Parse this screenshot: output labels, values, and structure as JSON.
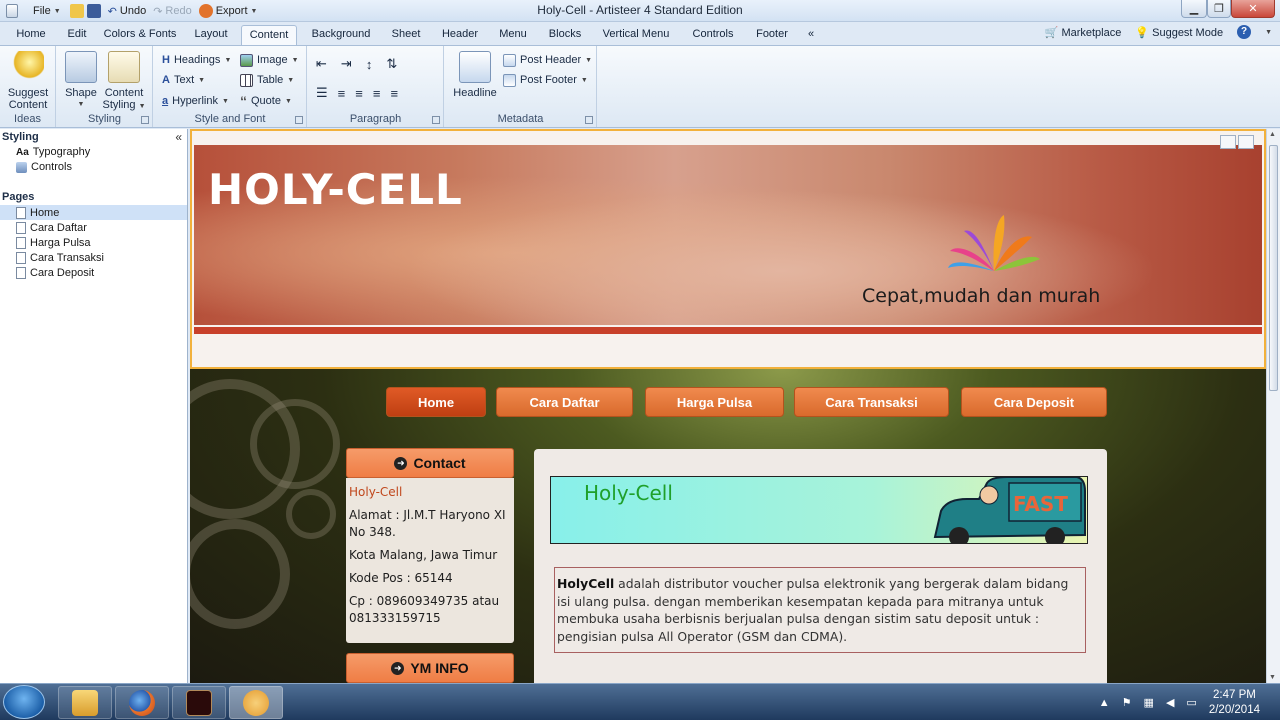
{
  "window": {
    "title": "Holy-Cell - Artisteer 4 Standard Edition",
    "quick_access": {
      "file": "File",
      "undo": "Undo",
      "redo": "Redo",
      "export": "Export"
    }
  },
  "ribbon_tabs": [
    "Home",
    "Edit",
    "Colors & Fonts",
    "Layout",
    "Content",
    "Background",
    "Sheet",
    "Header",
    "Menu",
    "Blocks",
    "Vertical Menu",
    "Controls",
    "Footer",
    "«"
  ],
  "active_tab": "Content",
  "right_links": {
    "marketplace": "Marketplace",
    "suggest_mode": "Suggest Mode"
  },
  "ribbon": {
    "ideas": {
      "label": "Ideas",
      "suggest_line1": "Suggest",
      "suggest_line2": "Content"
    },
    "styling": {
      "label": "Styling",
      "shape": "Shape",
      "content_styling_line1": "Content",
      "content_styling_line2": "Styling"
    },
    "style_font": {
      "label": "Style and Font",
      "headings": "Headings",
      "text": "Text",
      "hyperlink": "Hyperlink",
      "image": "Image",
      "table": "Table",
      "quote": "Quote"
    },
    "paragraph": {
      "label": "Paragraph"
    },
    "metadata": {
      "label": "Metadata",
      "headline": "Headline",
      "post_header": "Post Header",
      "post_footer": "Post Footer"
    }
  },
  "left_panel": {
    "styling_title": "Styling",
    "styling_items": [
      "Typography",
      "Controls"
    ],
    "typography_prefix": "Aa",
    "pages_title": "Pages",
    "pages": [
      "Home",
      "Cara Daftar",
      "Harga Pulsa",
      "Cara Transaksi",
      "Cara Deposit"
    ],
    "selected_page": "Home"
  },
  "site": {
    "title": "HOLY-CELL",
    "slogan": "Cepat,mudah dan murah",
    "menu": [
      "Home",
      "Cara Daftar",
      "Harga Pulsa",
      "Cara Transaksi",
      "Cara Deposit"
    ],
    "active_menu": "Home",
    "contact": {
      "heading": "Contact",
      "name": "Holy-Cell",
      "address": "Alamat : Jl.M.T Haryono XI No 348.",
      "city": "Kota Malang, Jawa Timur",
      "postal": "Kode Pos : 65144",
      "phone": "Cp : 089609349735 atau 081333159715"
    },
    "ym_heading": "YM INFO",
    "banner_text": "Holy-Cell",
    "van_text": "FAST",
    "description_bold": "HolyCell",
    "description_rest": " adalah distributor voucher pulsa elektronik yang bergerak dalam bidang isi ulang pulsa. dengan memberikan kesempatan kepada para mitranya untuk membuka usaha berbisnis berjualan pulsa dengan sistim satu deposit untuk : pengisian pulsa All Operator (GSM dan CDMA)."
  },
  "taskbar": {
    "time": "2:47 PM",
    "date": "2/20/2014"
  },
  "colors": {
    "accent_orange": "#ef7d45",
    "header_stripe": "#c8402a",
    "ribbon_bg": "#dfe9f5"
  }
}
